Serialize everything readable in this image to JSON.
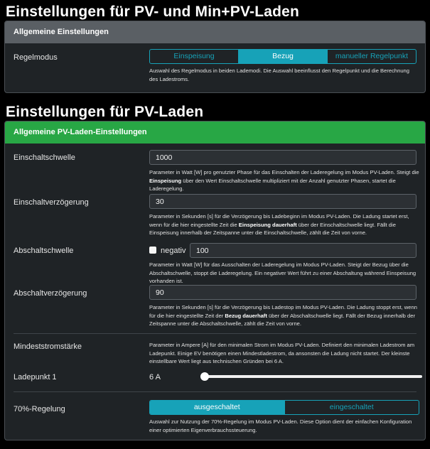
{
  "section1": {
    "title": "Einstellungen für PV- und Min+PV-Laden",
    "card_header": "Allgemeine Einstellungen",
    "regelmodus": {
      "label": "Regelmodus",
      "options": [
        "Einspeisung",
        "Bezug",
        "manueller Regelpunkt"
      ],
      "selected": "Bezug",
      "help": "Auswahl des Regelmodus in beiden Lademodi. Die Auswahl beeinflusst den Regelpunkt und die Berechnung des Ladestroms."
    }
  },
  "section2": {
    "title": "Einstellungen für PV-Laden",
    "card_header": "Allgemeine PV-Laden-Einstellungen",
    "einschaltschwelle": {
      "label": "Einschaltschwelle",
      "value": "1000",
      "help_pre": "Parameter in Watt [W] pro genutzter Phase für das Einschalten der Laderegelung im Modus PV-Laden. Steigt die ",
      "help_bold": "Einspeisung",
      "help_post": " über den Wert Einschaltschwelle multipliziert mit der Anzahl genutzter Phasen, startet die Laderegelung."
    },
    "einschaltverzoegerung": {
      "label": "Einschaltverzögerung",
      "value": "30",
      "help_pre": "Parameter in Sekunden [s] für die Verzögerung bis Ladebeginn im Modus PV-Laden. Die Ladung startet erst, wenn für die hier eingestellte Zeit die ",
      "help_bold": "Einspeisung dauerhaft",
      "help_post": " über der Einschaltschwelle liegt. Fällt die Einspeisung innerhalb der Zeitspanne unter die Einschaltschwelle, zählt die Zeit von vorne."
    },
    "abschaltschwelle": {
      "label": "Abschaltschwelle",
      "negativ_label": "negativ",
      "negativ_checked": false,
      "value": "100",
      "help": "Parameter in Watt [W] für das Ausschalten der Laderegelung im Modus PV-Laden. Steigt der Bezug über die Abschaltschwelle, stoppt die Laderegelung. Ein negativer Wert führt zu einer Abschaltung während Einspeisung vorhanden ist."
    },
    "abschaltverzoegerung": {
      "label": "Abschaltverzögerung",
      "value": "90",
      "help_pre": "Parameter in Sekunden [s] für die Verzögerung bis Ladestop im Modus PV-Laden. Die Ladung stoppt erst, wenn für die hier eingestellte Zeit der ",
      "help_bold": "Bezug dauerhaft",
      "help_post": " über der Abschaltschwelle liegt. Fällt der Bezug innerhalb der Zeitspanne unter die Abschaltschwelle, zählt die Zeit von vorne."
    },
    "mindeststrom": {
      "label": "Mindeststromstärke",
      "help": "Parameter in Ampere [A] für den minimalen Strom im Modus PV-Laden. Definiert den minimalen Ladestrom am Ladepunkt. Einige EV benötigen einen Mindestladestrom, da ansonsten die Ladung nicht startet. Der kleinste einstellbare Wert liegt aus technischen Gründen bei 6 A.",
      "ladepunkt_label": "Ladepunkt 1",
      "ladepunkt_value": "6 A",
      "slider_fraction": 0.0
    },
    "regelung70": {
      "label": "70%-Regelung",
      "options": [
        "ausgeschaltet",
        "eingeschaltet"
      ],
      "selected": "ausgeschaltet",
      "help": "Auswahl zur Nutzung der 70%-Regelung im Modus PV-Laden. Diese Option dient der einfachen Konfiguration einer optimierten Eigenverbrauchssteuerung."
    }
  },
  "colors": {
    "accent": "#17a2b8",
    "green_header": "#28a745",
    "gray_header": "#5a5f64"
  }
}
